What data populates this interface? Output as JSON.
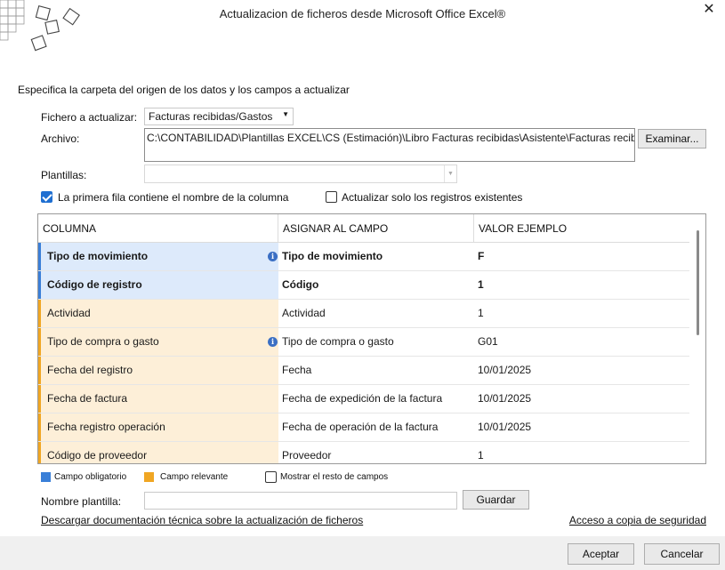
{
  "window": {
    "title": "Actualizacion de ficheros desde Microsoft Office Excel®",
    "close_label": "✕"
  },
  "instruction": "Especifica la carpeta del origen de los datos y los campos a actualizar",
  "form": {
    "fichero_label": "Fichero a actualizar:",
    "fichero_value": "Facturas recibidas/Gastos",
    "archivo_label": "Archivo:",
    "archivo_value": "C:\\CONTABILIDAD\\Plantillas EXCEL\\CS (Estimación)\\Libro Facturas recibidas\\Asistente\\Facturas recibidas asis",
    "examinar_label": "Examinar...",
    "plantillas_label": "Plantillas:",
    "plantillas_value": "",
    "chk_primera_fila": {
      "label": "La primera fila contiene el nombre de la columna",
      "checked": true
    },
    "chk_actualizar_existentes": {
      "label": "Actualizar solo los registros existentes",
      "checked": false
    }
  },
  "grid": {
    "headers": [
      "COLUMNA",
      "ASIGNAR AL CAMPO",
      "VALOR EJEMPLO"
    ],
    "rows": [
      {
        "columna": "Tipo de movimiento",
        "campo": "Tipo de movimiento",
        "valor": "F",
        "kind": "required",
        "info": true
      },
      {
        "columna": "Código de registro",
        "campo": "Código",
        "valor": "1",
        "kind": "required",
        "info": false
      },
      {
        "columna": "Actividad",
        "campo": "Actividad",
        "valor": "1",
        "kind": "relevant",
        "info": false
      },
      {
        "columna": "Tipo de compra o gasto",
        "campo": "Tipo de compra o gasto",
        "valor": "G01",
        "kind": "relevant",
        "info": true
      },
      {
        "columna": "Fecha del registro",
        "campo": "Fecha",
        "valor": "10/01/2025",
        "kind": "relevant",
        "info": false
      },
      {
        "columna": "Fecha de factura",
        "campo": "Fecha de expedición de la factura",
        "valor": "10/01/2025",
        "kind": "relevant",
        "info": false
      },
      {
        "columna": "Fecha registro operación",
        "campo": "Fecha de operación de la factura",
        "valor": "10/01/2025",
        "kind": "relevant",
        "info": false
      },
      {
        "columna": "Código de proveedor",
        "campo": "Proveedor",
        "valor": "1",
        "kind": "relevant",
        "info": false
      }
    ]
  },
  "legend": {
    "obligatorio": {
      "label": "Campo obligatorio",
      "color": "#3a7fd8"
    },
    "relevante": {
      "label": "Campo relevante",
      "color": "#f0a623"
    },
    "mostrar_resto": {
      "label": "Mostrar el resto de campos",
      "checked": false
    }
  },
  "nombre_plantilla": {
    "label": "Nombre plantilla:",
    "value": "",
    "guardar_label": "Guardar"
  },
  "links": {
    "doc": "Descargar documentación técnica sobre la actualización de ficheros",
    "backup": "Acceso a copia de seguridad"
  },
  "footer": {
    "aceptar": "Aceptar",
    "cancelar": "Cancelar"
  },
  "icons": {
    "info": "info-icon",
    "dropdown": "chevron-down-icon",
    "close": "close-icon",
    "logo": "logo-squares-icon"
  }
}
